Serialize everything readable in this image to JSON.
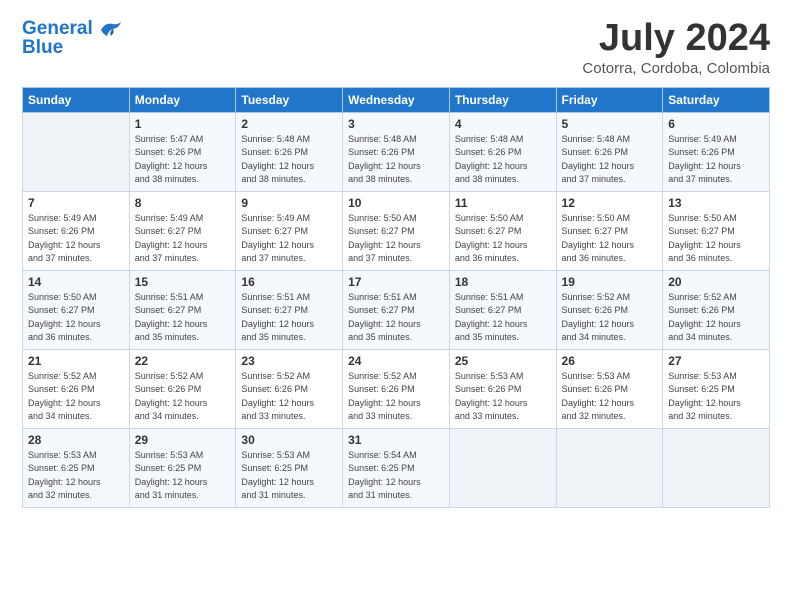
{
  "header": {
    "logo_line1": "General",
    "logo_line2": "Blue",
    "month": "July 2024",
    "location": "Cotorra, Cordoba, Colombia"
  },
  "weekdays": [
    "Sunday",
    "Monday",
    "Tuesday",
    "Wednesday",
    "Thursday",
    "Friday",
    "Saturday"
  ],
  "weeks": [
    [
      {
        "day": "",
        "info": ""
      },
      {
        "day": "1",
        "info": "Sunrise: 5:47 AM\nSunset: 6:26 PM\nDaylight: 12 hours\nand 38 minutes."
      },
      {
        "day": "2",
        "info": "Sunrise: 5:48 AM\nSunset: 6:26 PM\nDaylight: 12 hours\nand 38 minutes."
      },
      {
        "day": "3",
        "info": "Sunrise: 5:48 AM\nSunset: 6:26 PM\nDaylight: 12 hours\nand 38 minutes."
      },
      {
        "day": "4",
        "info": "Sunrise: 5:48 AM\nSunset: 6:26 PM\nDaylight: 12 hours\nand 38 minutes."
      },
      {
        "day": "5",
        "info": "Sunrise: 5:48 AM\nSunset: 6:26 PM\nDaylight: 12 hours\nand 37 minutes."
      },
      {
        "day": "6",
        "info": "Sunrise: 5:49 AM\nSunset: 6:26 PM\nDaylight: 12 hours\nand 37 minutes."
      }
    ],
    [
      {
        "day": "7",
        "info": "Sunrise: 5:49 AM\nSunset: 6:26 PM\nDaylight: 12 hours\nand 37 minutes."
      },
      {
        "day": "8",
        "info": "Sunrise: 5:49 AM\nSunset: 6:27 PM\nDaylight: 12 hours\nand 37 minutes."
      },
      {
        "day": "9",
        "info": "Sunrise: 5:49 AM\nSunset: 6:27 PM\nDaylight: 12 hours\nand 37 minutes."
      },
      {
        "day": "10",
        "info": "Sunrise: 5:50 AM\nSunset: 6:27 PM\nDaylight: 12 hours\nand 37 minutes."
      },
      {
        "day": "11",
        "info": "Sunrise: 5:50 AM\nSunset: 6:27 PM\nDaylight: 12 hours\nand 36 minutes."
      },
      {
        "day": "12",
        "info": "Sunrise: 5:50 AM\nSunset: 6:27 PM\nDaylight: 12 hours\nand 36 minutes."
      },
      {
        "day": "13",
        "info": "Sunrise: 5:50 AM\nSunset: 6:27 PM\nDaylight: 12 hours\nand 36 minutes."
      }
    ],
    [
      {
        "day": "14",
        "info": "Sunrise: 5:50 AM\nSunset: 6:27 PM\nDaylight: 12 hours\nand 36 minutes."
      },
      {
        "day": "15",
        "info": "Sunrise: 5:51 AM\nSunset: 6:27 PM\nDaylight: 12 hours\nand 35 minutes."
      },
      {
        "day": "16",
        "info": "Sunrise: 5:51 AM\nSunset: 6:27 PM\nDaylight: 12 hours\nand 35 minutes."
      },
      {
        "day": "17",
        "info": "Sunrise: 5:51 AM\nSunset: 6:27 PM\nDaylight: 12 hours\nand 35 minutes."
      },
      {
        "day": "18",
        "info": "Sunrise: 5:51 AM\nSunset: 6:27 PM\nDaylight: 12 hours\nand 35 minutes."
      },
      {
        "day": "19",
        "info": "Sunrise: 5:52 AM\nSunset: 6:26 PM\nDaylight: 12 hours\nand 34 minutes."
      },
      {
        "day": "20",
        "info": "Sunrise: 5:52 AM\nSunset: 6:26 PM\nDaylight: 12 hours\nand 34 minutes."
      }
    ],
    [
      {
        "day": "21",
        "info": "Sunrise: 5:52 AM\nSunset: 6:26 PM\nDaylight: 12 hours\nand 34 minutes."
      },
      {
        "day": "22",
        "info": "Sunrise: 5:52 AM\nSunset: 6:26 PM\nDaylight: 12 hours\nand 34 minutes."
      },
      {
        "day": "23",
        "info": "Sunrise: 5:52 AM\nSunset: 6:26 PM\nDaylight: 12 hours\nand 33 minutes."
      },
      {
        "day": "24",
        "info": "Sunrise: 5:52 AM\nSunset: 6:26 PM\nDaylight: 12 hours\nand 33 minutes."
      },
      {
        "day": "25",
        "info": "Sunrise: 5:53 AM\nSunset: 6:26 PM\nDaylight: 12 hours\nand 33 minutes."
      },
      {
        "day": "26",
        "info": "Sunrise: 5:53 AM\nSunset: 6:26 PM\nDaylight: 12 hours\nand 32 minutes."
      },
      {
        "day": "27",
        "info": "Sunrise: 5:53 AM\nSunset: 6:25 PM\nDaylight: 12 hours\nand 32 minutes."
      }
    ],
    [
      {
        "day": "28",
        "info": "Sunrise: 5:53 AM\nSunset: 6:25 PM\nDaylight: 12 hours\nand 32 minutes."
      },
      {
        "day": "29",
        "info": "Sunrise: 5:53 AM\nSunset: 6:25 PM\nDaylight: 12 hours\nand 31 minutes."
      },
      {
        "day": "30",
        "info": "Sunrise: 5:53 AM\nSunset: 6:25 PM\nDaylight: 12 hours\nand 31 minutes."
      },
      {
        "day": "31",
        "info": "Sunrise: 5:54 AM\nSunset: 6:25 PM\nDaylight: 12 hours\nand 31 minutes."
      },
      {
        "day": "",
        "info": ""
      },
      {
        "day": "",
        "info": ""
      },
      {
        "day": "",
        "info": ""
      }
    ]
  ]
}
